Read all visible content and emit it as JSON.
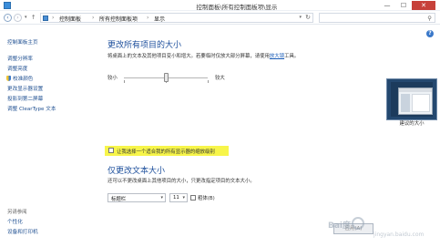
{
  "window": {
    "title": "控制面板\\所有控制面板项\\显示",
    "min_symbol": "—",
    "max_symbol": "☐",
    "close_symbol": "✕"
  },
  "address": {
    "back_symbol": "‹",
    "forward_symbol": "›",
    "dropdown_symbol": "▾",
    "up_symbol": "↑",
    "crumb_sep": "›",
    "crumbs": [
      "控制面板",
      "所有控制面板项",
      "显示"
    ],
    "refresh_symbol": "↻",
    "search_symbol": "⚲"
  },
  "help": {
    "symbol": "?"
  },
  "sidebar": {
    "home": "控制面板主页",
    "links": [
      "调整分辨率",
      "调整亮度",
      "校准颜色",
      "更改显示器设置",
      "投影到第二屏幕",
      "调整 ClearType 文本"
    ],
    "see_also": "另请参阅",
    "related": [
      "个性化",
      "设备和打印机"
    ]
  },
  "main": {
    "heading1": "更改所有项目的大小",
    "desc1_before": "将桌面上的文本及其他项目变小和增大。若要临时仅放大部分屏幕，请使用",
    "desc1_link": "放大镜",
    "desc1_after": "工具。",
    "slider_min": "较小",
    "slider_max": "较大",
    "slider_level_percent": 50,
    "preview_caption": "建议的大小",
    "checkbox1_label": "让我选择一个适合我的所有显示器的缩放级别",
    "heading2": "仅更改文本大小",
    "desc2": "还可以不更改桌面上其他项目的大小，只更改指定项目的文本大小。",
    "item_select": "标题栏",
    "size_select": "11",
    "select_arrow": "▾",
    "bold_label": "粗体(B)",
    "apply_button": "应用(A)"
  },
  "watermark": {
    "text": "Bai度",
    "sub": "jingyan.baidu.com"
  },
  "colors": {
    "accent": "#1d4f9c",
    "link": "#1e4f91",
    "highlight": "#f7f54a",
    "close": "#c7413a"
  }
}
